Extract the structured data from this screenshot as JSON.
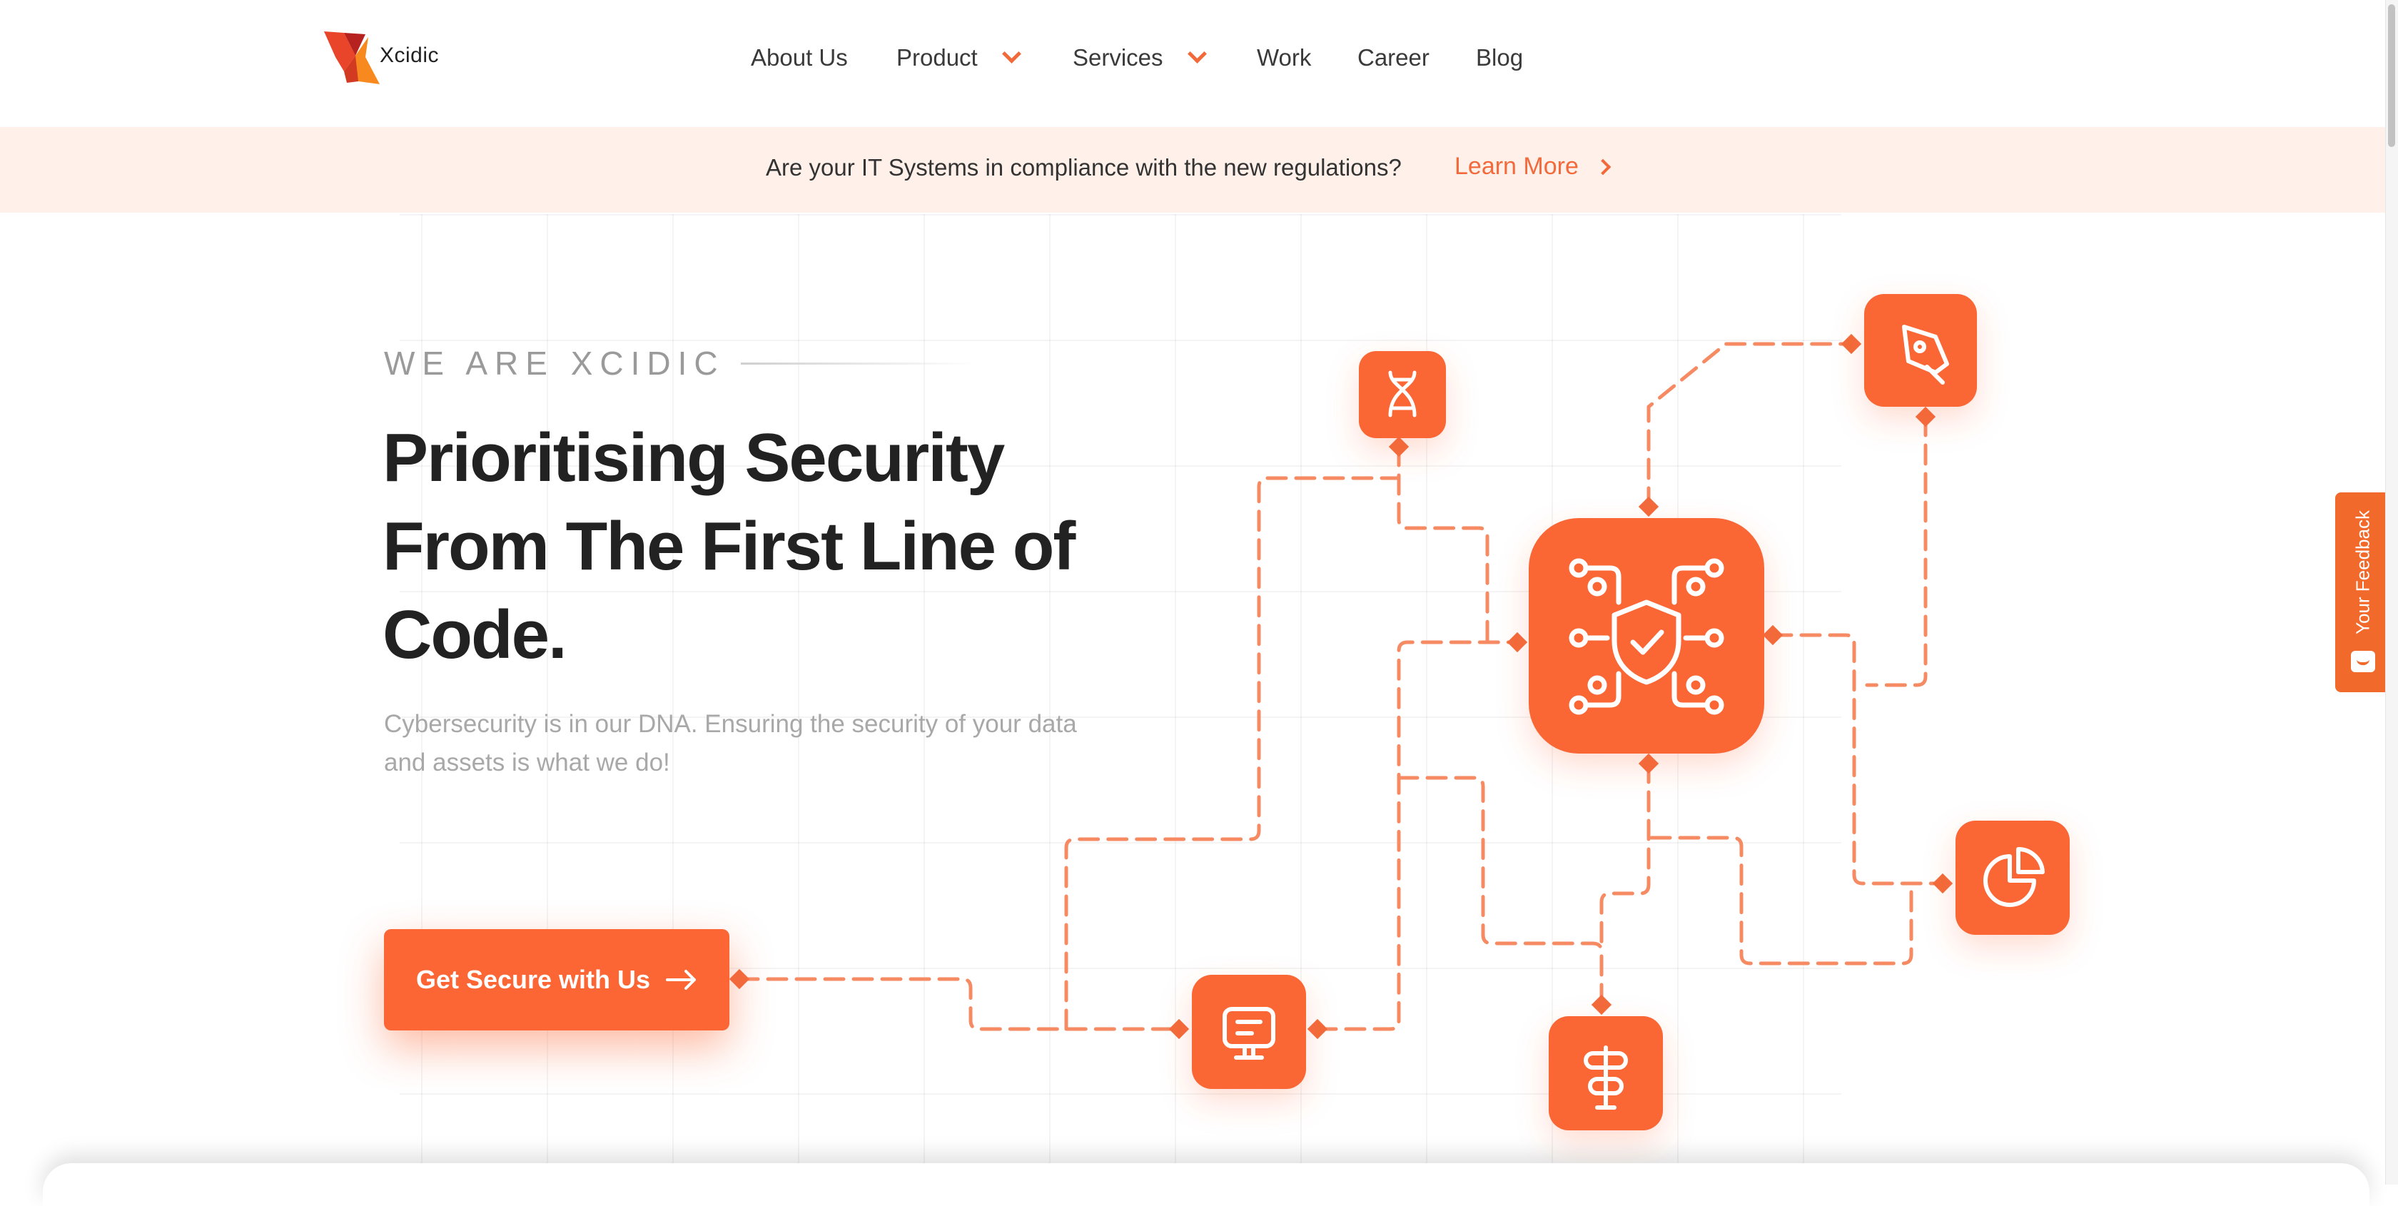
{
  "brand": {
    "name": "Xcidic"
  },
  "nav": {
    "items": [
      {
        "label": "About Us",
        "dropdown": false
      },
      {
        "label": "Product",
        "dropdown": true
      },
      {
        "label": "Services",
        "dropdown": true
      },
      {
        "label": "Work",
        "dropdown": false
      },
      {
        "label": "Career",
        "dropdown": false
      },
      {
        "label": "Blog",
        "dropdown": false
      }
    ]
  },
  "banner": {
    "text": "Are your IT Systems in compliance with the new regulations?",
    "link_label": "Learn More"
  },
  "hero": {
    "eyebrow": "WE ARE XCIDIC",
    "headline_lines": [
      "Prioritising Security",
      "From The First Line of",
      "Code."
    ],
    "subtitle": "Cybersecurity is in our DNA. Ensuring the security of your data and assets is what we do!",
    "cta_label": "Get Secure with Us"
  },
  "diagram": {
    "nodes": [
      {
        "icon": "dna-icon"
      },
      {
        "icon": "pen-tool-icon"
      },
      {
        "icon": "shield-circuit-icon"
      },
      {
        "icon": "pie-chart-icon"
      },
      {
        "icon": "monitor-icon"
      },
      {
        "icon": "signpost-icon"
      }
    ]
  },
  "feedback": {
    "label": "Your Feedback"
  },
  "colors": {
    "accent": "#fb6634",
    "banner_bg": "#fff1e9",
    "text_dark": "#222222",
    "text_muted": "#a8a8a8"
  }
}
